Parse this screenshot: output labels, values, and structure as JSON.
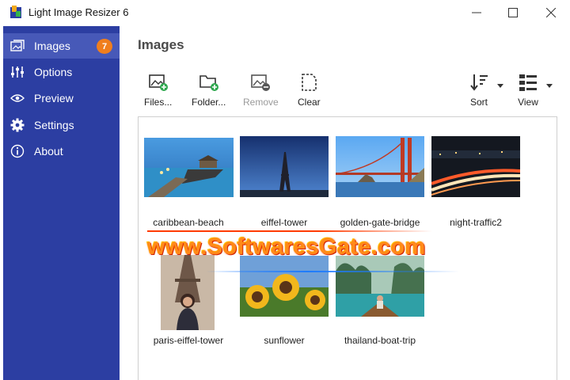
{
  "window": {
    "title": "Light Image Resizer 6",
    "controls": [
      "minimize",
      "maximize",
      "close"
    ]
  },
  "sidebar": {
    "items": [
      {
        "label": "Images",
        "icon": "images-icon",
        "active": true,
        "badge": "7"
      },
      {
        "label": "Options",
        "icon": "sliders-icon"
      },
      {
        "label": "Preview",
        "icon": "eye-icon"
      },
      {
        "label": "Settings",
        "icon": "gear-icon"
      },
      {
        "label": "About",
        "icon": "info-icon"
      }
    ]
  },
  "main": {
    "title": "Images",
    "toolbar": {
      "files": "Files...",
      "folder": "Folder...",
      "remove": "Remove",
      "clear": "Clear",
      "sort": "Sort",
      "view": "View"
    },
    "images": [
      {
        "name": "caribbean-beach"
      },
      {
        "name": "eiffel-tower"
      },
      {
        "name": "golden-gate-bridge"
      },
      {
        "name": "night-traffic2"
      },
      {
        "name": "paris-eiffel-tower"
      },
      {
        "name": "sunflower"
      },
      {
        "name": "thailand-boat-trip"
      }
    ]
  },
  "watermark": "www.SoftwaresGate.com",
  "colors": {
    "sidebar": "#2c3ea2",
    "sidebar_active": "#4759b8",
    "badge": "#f07e1d",
    "accent_green": "#2fa84f",
    "watermark": "#ff8a1a"
  }
}
